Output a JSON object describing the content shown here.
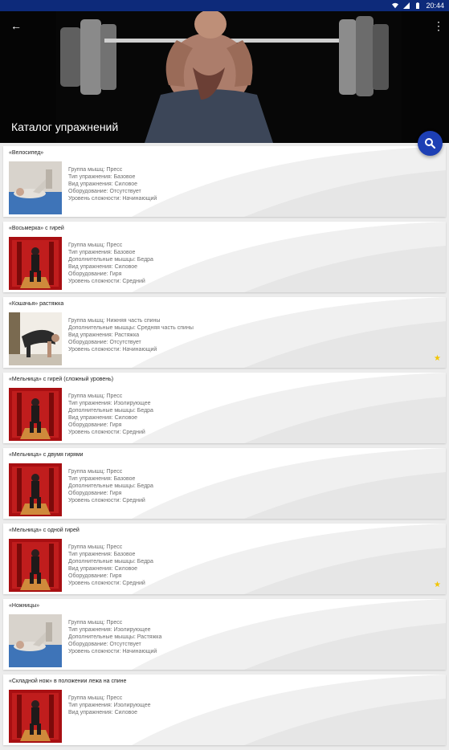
{
  "status_bar": {
    "time": "20:44"
  },
  "header": {
    "title": "Каталог упражнений",
    "search_icon": "search-icon"
  },
  "exercises": [
    {
      "title": "«Велосипед»",
      "favorite": false,
      "thumb": "floor-blue",
      "details": [
        "Группа мышц: Пресс",
        "Тип упражнения: Базовое",
        "Вид упражнения: Силовое",
        "Оборудование: Отсутствует",
        "Уровень сложности: Начинающий"
      ]
    },
    {
      "title": "«Восьмерка» с гирей",
      "favorite": false,
      "thumb": "gym-red",
      "details": [
        "Группа мышц: Пресс",
        "Тип упражнения: Базовое",
        "Дополнительные мышцы: Бедра",
        "Вид упражнения: Силовое",
        "Оборудование: Гиря",
        "Уровень сложности: Средний"
      ]
    },
    {
      "title": "«Кошачья» растяжка",
      "favorite": true,
      "thumb": "stretch-light",
      "details": [
        "Группа мышц: Нижняя часть спины",
        "Дополнительные мышцы: Средняя часть спины",
        "Вид упражнения: Растяжка",
        "Оборудование: Отсутствует",
        "Уровень сложности: Начинающий"
      ]
    },
    {
      "title": "«Мельница» с гирей (сложный уровень)",
      "favorite": false,
      "thumb": "gym-red",
      "details": [
        "Группа мышц: Пресс",
        "Тип упражнения: Изолирующее",
        "Дополнительные мышцы: Бедра",
        "Вид упражнения: Силовое",
        "Оборудование: Гиря",
        "Уровень сложности: Средний"
      ]
    },
    {
      "title": "«Мельница» с двумя гирями",
      "favorite": false,
      "thumb": "gym-red",
      "details": [
        "Группа мышц: Пресс",
        "Тип упражнения: Базовое",
        "Дополнительные мышцы: Бедра",
        "Оборудование: Гиря",
        "Уровень сложности: Средний"
      ]
    },
    {
      "title": "«Мельница» с одной гирей",
      "favorite": true,
      "thumb": "gym-red",
      "details": [
        "Группа мышц: Пресс",
        "Тип упражнения: Базовое",
        "Дополнительные мышцы: Бедра",
        "Вид упражнения: Силовое",
        "Оборудование: Гиря",
        "Уровень сложности: Средний"
      ]
    },
    {
      "title": "«Ножницы»",
      "favorite": false,
      "thumb": "floor-blue",
      "details": [
        "Группа мышц: Пресс",
        "Тип упражнения: Изолирующее",
        "Дополнительные мышцы: Растяжка",
        "Оборудование: Отсутствует",
        "Уровень сложности: Начинающий"
      ]
    },
    {
      "title": "«Складной нож» в положении лежа на спине",
      "favorite": false,
      "thumb": "gym-red",
      "details": [
        "Группа мышц: Пресс",
        "Тип упражнения: Изолирующее",
        "Вид упражнения: Силовое"
      ]
    }
  ],
  "colors": {
    "status_bar": "#0d2a7a",
    "fab": "#1d3fb4",
    "star": "#f2c500",
    "header_bg": "#050505"
  }
}
